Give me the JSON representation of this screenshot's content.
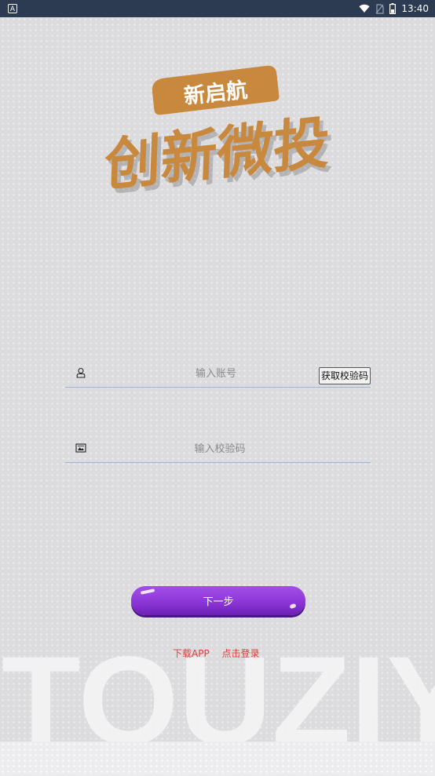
{
  "status_bar": {
    "time": "13:40"
  },
  "logo": {
    "tag_text": "新启航",
    "main_text": "创新微投"
  },
  "form": {
    "account_placeholder": "输入账号",
    "get_code_label": "获取校验码",
    "code_placeholder": "输入校验码"
  },
  "actions": {
    "next_label": "下一步",
    "download_label": "下载APP",
    "login_label": "点击登录"
  },
  "watermark": {
    "text": "TOUZIY"
  },
  "colors": {
    "status_bar": "#2c3a52",
    "logo_orange": "#c8893e",
    "button_purple": "#8a34d6",
    "link_red": "#e03b3b",
    "field_underline": "#9fb3cf"
  }
}
